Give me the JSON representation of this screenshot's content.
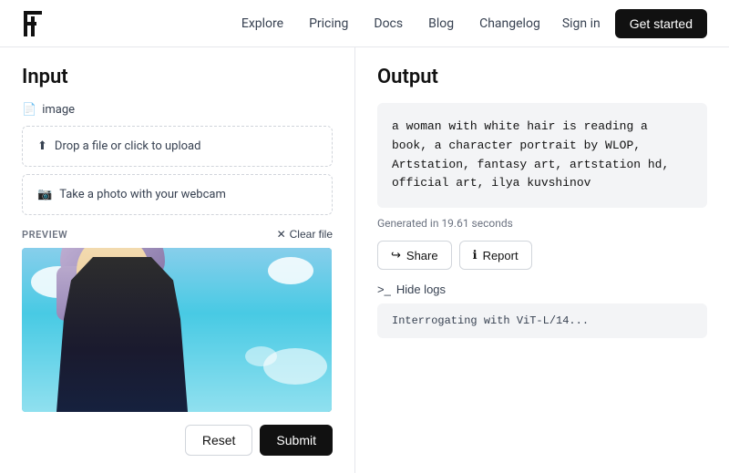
{
  "nav": {
    "links": [
      {
        "label": "Explore",
        "id": "explore"
      },
      {
        "label": "Pricing",
        "id": "pricing"
      },
      {
        "label": "Docs",
        "id": "docs"
      },
      {
        "label": "Blog",
        "id": "blog"
      },
      {
        "label": "Changelog",
        "id": "changelog"
      }
    ],
    "signin_label": "Sign in",
    "cta_label": "Get started"
  },
  "left": {
    "title": "Input",
    "image_label": "image",
    "upload_label": "Drop a file or click to upload",
    "webcam_label": "Take a photo with your webcam",
    "preview_label": "PREVIEW",
    "clear_file_label": "Clear file",
    "reset_label": "Reset",
    "submit_label": "Submit"
  },
  "right": {
    "title": "Output",
    "output_text": "a woman with white hair is reading a\nbook, a character portrait by WLOP,\nArtstation, fantasy art, artstation hd,\nofficial art, ilya kuvshinov",
    "generated_time": "Generated in 19.61 seconds",
    "share_label": "Share",
    "report_label": "Report",
    "hide_logs_label": "Hide logs",
    "logs_text": "Interrogating with ViT-L/14..."
  }
}
